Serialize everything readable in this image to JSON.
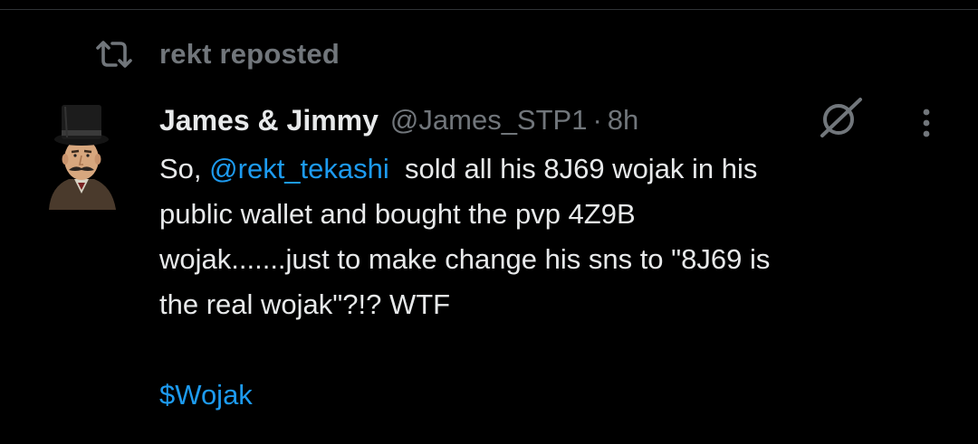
{
  "repost": {
    "icon": "repost-icon",
    "label": "rekt reposted"
  },
  "author": {
    "display_name": "James & Jimmy",
    "handle": "@James_STP1",
    "separator": "·",
    "time": "8h",
    "avatar": "avatar-top-hat-mustache-man"
  },
  "actions": {
    "grok_icon": "grok-icon",
    "more_icon": "more-options-icon"
  },
  "tweet": {
    "line1_prefix": "So, ",
    "mention": "@rekt_tekashi",
    "line1_suffix": "  sold all his 8J69 wojak in his",
    "line2": "public wallet and bought the pvp 4Z9B",
    "line3": "wojak.......just to make change his sns to \"8J69 is",
    "line4": "the real wojak\"?!? WTF",
    "cashtag": "$Wojak"
  },
  "colors": {
    "background": "#000000",
    "text_primary": "#e7e9ea",
    "text_secondary": "#71767b",
    "link": "#1d9bf0",
    "divider": "#2f3336"
  }
}
